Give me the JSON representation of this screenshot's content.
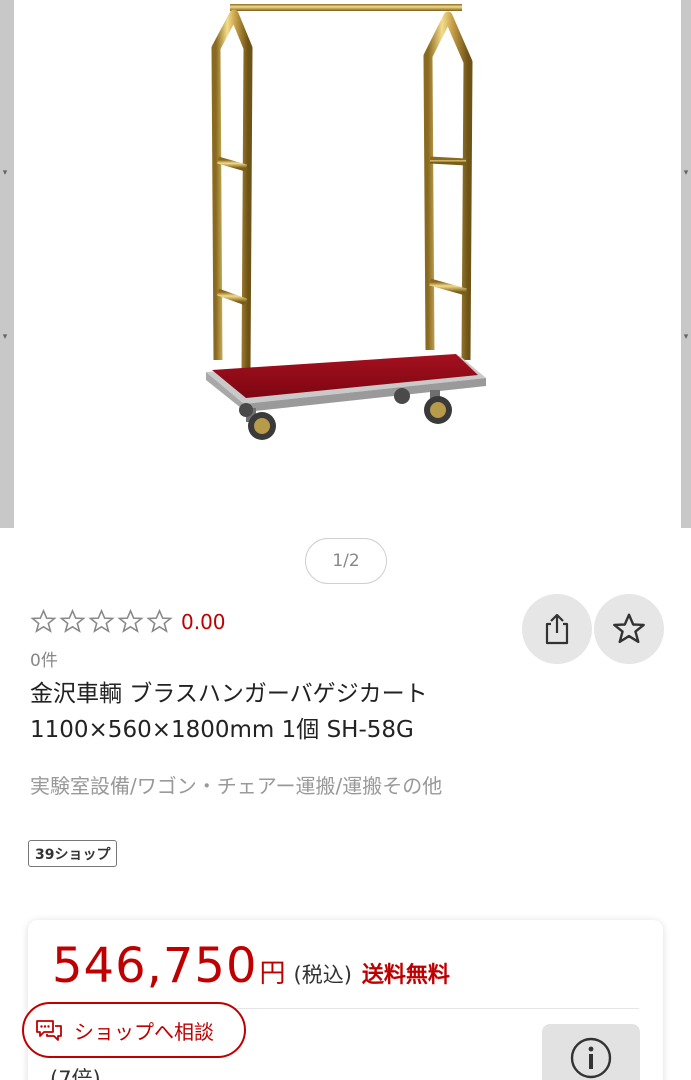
{
  "gallery": {
    "pager_text": "1/2"
  },
  "rating": {
    "score": "0.00",
    "stars_filled": 0,
    "stars_total": 5,
    "review_count": "0件"
  },
  "product": {
    "title_line1": "金沢車輌 ブラスハンガーバゲジカート",
    "title_line2": "1100×560×1800mm 1個 SH-58G",
    "category": "実験室設備/ワゴン・チェアー運搬/運搬その他",
    "shop_tag": "39ショップ"
  },
  "price": {
    "amount": "546,750",
    "currency": "円",
    "tax_note": "(税込)",
    "shipping": "送料無料",
    "points_partial": "(7倍)"
  },
  "consult": {
    "label": "ショップへ相談"
  },
  "colors": {
    "accent": "#bf0000",
    "muted_text": "#999999",
    "button_bg": "#e6e6e6"
  },
  "icons": {
    "share": "share-icon",
    "favorite": "star-outline-icon",
    "info": "info-icon",
    "chat": "chat-icon"
  }
}
